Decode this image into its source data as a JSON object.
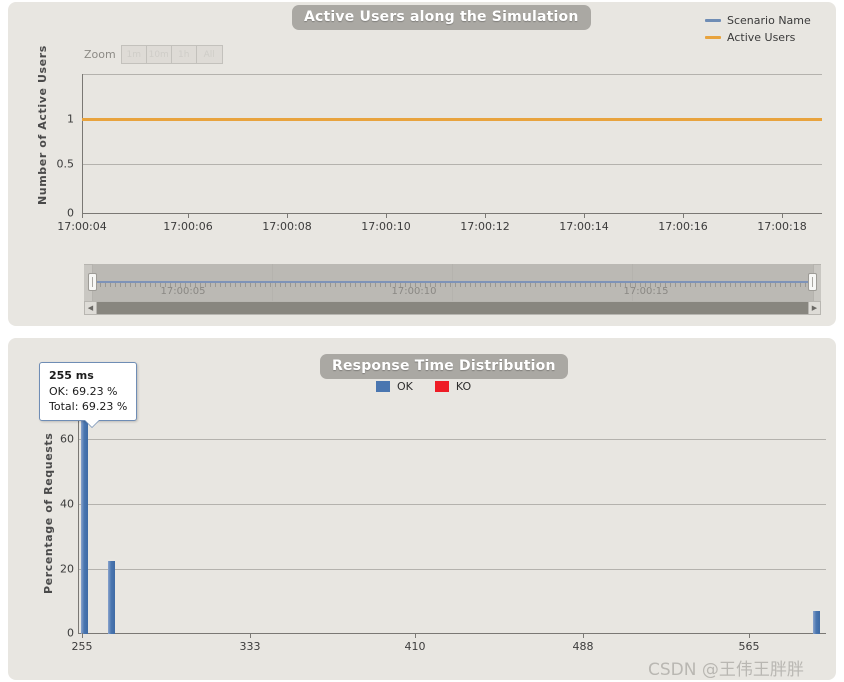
{
  "active_users_chart": {
    "title": "Active Users along the Simulation",
    "zoom": {
      "label": "Zoom",
      "buttons": [
        "1m",
        "10m",
        "1h",
        "All"
      ]
    },
    "legend": [
      {
        "label": "Scenario Name",
        "color": "#6f8db5"
      },
      {
        "label": "Active Users",
        "color": "#e8a33d"
      }
    ],
    "y_axis": {
      "title": "Number of Active Users",
      "ticks": [
        "0",
        "0.5",
        "1"
      ],
      "min": 0,
      "max": 1.25
    },
    "x_axis": {
      "ticks": [
        "17:00:04",
        "17:00:06",
        "17:00:08",
        "17:00:10",
        "17:00:12",
        "17:00:14",
        "17:00:16",
        "17:00:18"
      ]
    },
    "navigator": {
      "ticks": [
        "17:00:05",
        "17:00:10",
        "17:00:15"
      ]
    }
  },
  "response_time_chart": {
    "title": "Response Time Distribution",
    "legend": [
      {
        "label": "OK",
        "color": "#4a76b0"
      },
      {
        "label": "KO",
        "color": "#ee1c25"
      }
    ],
    "y_axis": {
      "title": "Percentage of Requests",
      "ticks": [
        "0",
        "20",
        "40",
        "60"
      ],
      "min": 0,
      "max": 72
    },
    "x_axis": {
      "ticks": [
        "255",
        "333",
        "410",
        "488",
        "565"
      ]
    },
    "tooltip": {
      "header": "255 ms",
      "ok": "OK: 69.23 %",
      "total": "Total: 69.23 %"
    }
  },
  "watermark": "CSDN @王伟王胖胖",
  "chart_data": [
    {
      "type": "line",
      "title": "Active Users along the Simulation",
      "xlabel": "",
      "ylabel": "Number of Active Users",
      "ylim": [
        0,
        1.25
      ],
      "grid": true,
      "legend_position": "top-right",
      "x": [
        "17:00:04",
        "17:00:06",
        "17:00:08",
        "17:00:10",
        "17:00:12",
        "17:00:14",
        "17:00:16",
        "17:00:18"
      ],
      "series": [
        {
          "name": "Scenario Name",
          "color": "#6f8db5",
          "values": [
            null,
            null,
            null,
            null,
            null,
            null,
            null,
            null
          ]
        },
        {
          "name": "Active Users",
          "color": "#e8a33d",
          "values": [
            1,
            1,
            1,
            1,
            1,
            1,
            1,
            1
          ]
        }
      ]
    },
    {
      "type": "bar",
      "title": "Response Time Distribution",
      "xlabel": "",
      "ylabel": "Percentage of Requests",
      "ylim": [
        0,
        72
      ],
      "xlim": [
        255,
        600
      ],
      "grid": true,
      "legend_position": "top-center",
      "categories": [
        "255",
        "333",
        "410",
        "488",
        "565"
      ],
      "series": [
        {
          "name": "OK",
          "color": "#4a76b0",
          "points": [
            {
              "x": 255,
              "y": 69.23
            },
            {
              "x": 268,
              "y": 23.08
            },
            {
              "x": 594,
              "y": 7.69
            }
          ]
        },
        {
          "name": "KO",
          "color": "#ee1c25",
          "points": []
        }
      ]
    }
  ]
}
